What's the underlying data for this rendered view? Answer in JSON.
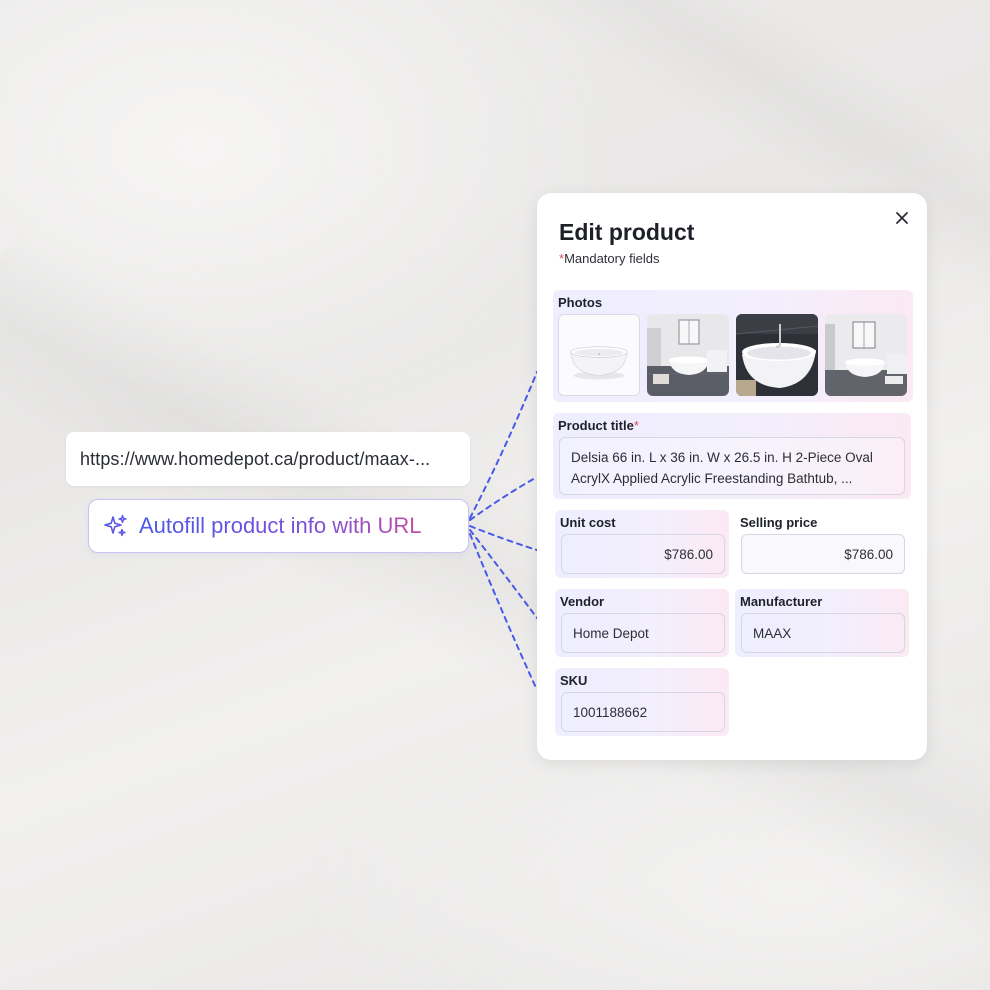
{
  "url_box": {
    "value": "https://www.homedepot.ca/product/maax-..."
  },
  "autofill": {
    "label": "Autofill product info with URL",
    "icon": "sparkle-icon"
  },
  "panel": {
    "title": "Edit product",
    "mandatory_star": "*",
    "mandatory_text": "Mandatory fields",
    "close_icon": "close-icon",
    "photos": {
      "label": "Photos",
      "items": [
        "bathtub-product-photo",
        "bathroom-photo-1",
        "bathtub-closeup-photo",
        "bathroom-photo-2"
      ]
    },
    "product_title": {
      "label": "Product title",
      "required": "*",
      "value": "Delsia 66 in. L x 36 in. W x 26.5 in. H 2-Piece Oval AcrylX Applied Acrylic Freestanding Bathtub, ..."
    },
    "unit_cost": {
      "label": "Unit cost",
      "value": "$786.00"
    },
    "selling_price": {
      "label": "Selling price",
      "value": "$786.00"
    },
    "vendor": {
      "label": "Vendor",
      "value": "Home Depot"
    },
    "manufacturer": {
      "label": "Manufacturer",
      "value": "MAAX"
    },
    "sku": {
      "label": "SKU",
      "value": "1001188662"
    }
  },
  "colors": {
    "accent_blue": "#4a5ae8",
    "accent_pink": "#c24fa7",
    "connector": "#4a5ae8",
    "required_star": "#e04a5a"
  }
}
